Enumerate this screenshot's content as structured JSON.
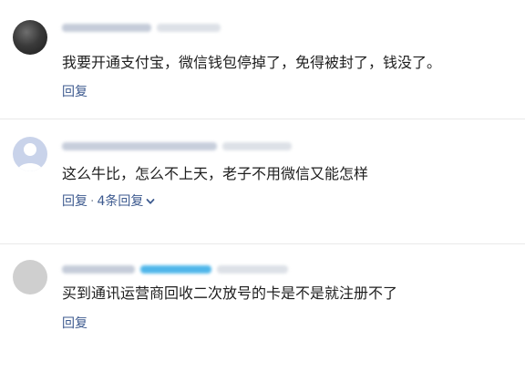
{
  "comments": [
    {
      "content": "我要开通支付宝，微信钱包停掉了，免得被封了，钱没了。",
      "reply": "回复"
    },
    {
      "content": "这么牛比，怎么不上天，老子不用微信又能怎样",
      "reply": "回复",
      "separator": "·",
      "replies_count": "4条回复"
    },
    {
      "content": "买到通讯运营商回收二次放号的卡是不是就注册不了",
      "reply": "回复"
    }
  ],
  "icons": {
    "expand": "chevron-down-icon",
    "default_avatar": "user-silhouette-icon"
  },
  "colors": {
    "link": "#3d5a8f",
    "text": "#1e1e1e",
    "divider": "#e9e9e9",
    "highlight": "#2ea9e6"
  }
}
